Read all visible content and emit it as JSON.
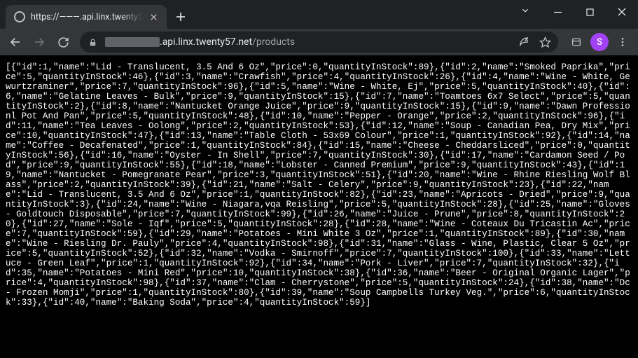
{
  "window": {
    "tab_title": "https://———.api.linx.twenty5",
    "url_redacted_prefix": true,
    "url_host": ".api.linx.twenty57.net",
    "url_path": "/products",
    "avatar_initial": "S"
  },
  "products": [
    {
      "id": 1,
      "name": "Lid - Translucent, 3.5 And 6 Oz",
      "price": 0,
      "quantityInStock": 89
    },
    {
      "id": 2,
      "name": "Smoked Paprika",
      "price": 5,
      "quantityInStock": 46
    },
    {
      "id": 3,
      "name": "Crawfish",
      "price": 4,
      "quantityInStock": 26
    },
    {
      "id": 4,
      "name": "Wine - White, Gewurtzraminer",
      "price": 7,
      "quantityInStock": 96
    },
    {
      "id": 5,
      "name": "Wine - White, Ej",
      "price": 5,
      "quantityInStock": 40
    },
    {
      "id": 6,
      "name": "Gelatine Leaves - Bulk",
      "price": 9,
      "quantityInStock": 15
    },
    {
      "id": 7,
      "name": "Toamtoes 6x7 Select",
      "price": 5,
      "quantityInStock": 2
    },
    {
      "id": 8,
      "name": "Nantucket Orange Juice",
      "price": 9,
      "quantityInStock": 15
    },
    {
      "id": 9,
      "name": "Dawn Professionl Pot And Pan",
      "price": 5,
      "quantityInStock": 48
    },
    {
      "id": 10,
      "name": "Pepper - Orange",
      "price": 2,
      "quantityInStock": 96
    },
    {
      "id": 11,
      "name": "Tea Leaves - Oolong",
      "price": 2,
      "quantityInStock": 53
    },
    {
      "id": 12,
      "name": "Soup - Canadian Pea, Dry Mix",
      "price": 10,
      "quantityInStock": 47
    },
    {
      "id": 13,
      "name": "Table Cloth - 53x69 Colour",
      "price": 1,
      "quantityInStock": 92
    },
    {
      "id": 14,
      "name": "Coffee - Decafenated",
      "price": 1,
      "quantityInStock": 84
    },
    {
      "id": 15,
      "name": "Cheese - Cheddarsliced",
      "price": 0,
      "quantityInStock": 56
    },
    {
      "id": 16,
      "name": "Oyster - In Shell",
      "price": 7,
      "quantityInStock": 30
    },
    {
      "id": 17,
      "name": "Cardamon Seed / Pod",
      "price": 9,
      "quantityInStock": 55
    },
    {
      "id": 18,
      "name": "Lobster - Canned Premium",
      "price": 9,
      "quantityInStock": 43
    },
    {
      "id": 19,
      "name": "Nantucket - Pomegranate Pear",
      "price": 3,
      "quantityInStock": 51
    },
    {
      "id": 20,
      "name": "Wine - Rhine Riesling Wolf Blass",
      "price": 2,
      "quantityInStock": 39
    },
    {
      "id": 21,
      "name": "Salt - Celery",
      "price": 9,
      "quantityInStock": 23
    },
    {
      "id": 22,
      "name": "Lid - Translucent, 3.5 And 6 Oz",
      "price": 1,
      "quantityInStock": 82
    },
    {
      "id": 23,
      "name": "Apricots - Dried",
      "price": 9,
      "quantityInStock": 3
    },
    {
      "id": 24,
      "name": "Wine - Niagara,vqa Reisling",
      "price": 5,
      "quantityInStock": 28
    },
    {
      "id": 25,
      "name": "Gloves - Goldtouch Disposable",
      "price": 7,
      "quantityInStock": 99
    },
    {
      "id": 26,
      "name": "Juice - Prune",
      "price": 8,
      "quantityInStock": 20
    },
    {
      "id": 27,
      "name": "Sole - Iqf",
      "price": 5,
      "quantityInStock": 28
    },
    {
      "id": 28,
      "name": "Wine - Coteaux Du Tricastin Ac",
      "price": 7,
      "quantityInStock": 59
    },
    {
      "id": 29,
      "name": "Potatoes - Mini White 3 Oz",
      "price": 1,
      "quantityInStock": 89
    },
    {
      "id": 30,
      "name": "Wine - Riesling Dr. Pauly",
      "price": 4,
      "quantityInStock": 98
    },
    {
      "id": 31,
      "name": "Glass - Wine, Plastic, Clear 5 Oz",
      "price": 5,
      "quantityInStock": 52
    },
    {
      "id": 32,
      "name": "Vodka - Smirnoff",
      "price": 7,
      "quantityInStock": 100
    },
    {
      "id": 33,
      "name": "Lettuce - Green Leaf",
      "price": 1,
      "quantityInStock": 92
    },
    {
      "id": 34,
      "name": "Pork - Liver",
      "price": 7,
      "quantityInStock": 32
    },
    {
      "id": 35,
      "name": "Potatoes - Mini Red",
      "price": 10,
      "quantityInStock": 38
    },
    {
      "id": 36,
      "name": "Beer - Original Organic Lager",
      "price": 4,
      "quantityInStock": 98
    },
    {
      "id": 37,
      "name": "Clam - Cherrystone",
      "price": 5,
      "quantityInStock": 24
    },
    {
      "id": 38,
      "name": "Dc - Frozen Momji",
      "price": 1,
      "quantityInStock": 80
    },
    {
      "id": 39,
      "name": "Soup Campbells Turkey Veg.",
      "price": 6,
      "quantityInStock": 33
    },
    {
      "id": 40,
      "name": "Baking Soda",
      "price": 4,
      "quantityInStock": 59
    }
  ]
}
